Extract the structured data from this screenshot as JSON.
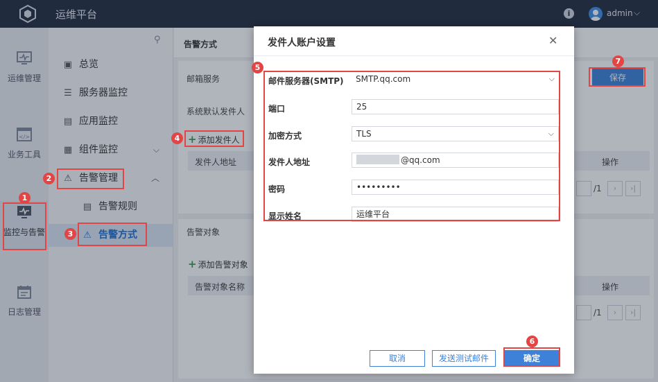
{
  "topbar": {
    "title": "运维平台",
    "user": "admin"
  },
  "rail": [
    {
      "label": "运维管理",
      "icon": "pulse-monitor-icon"
    },
    {
      "label": "业务工具",
      "icon": "code-window-icon"
    },
    {
      "label": "监控与告警",
      "icon": "monitor-alarm-icon",
      "active": true
    },
    {
      "label": "日志管理",
      "icon": "calendar-log-icon"
    }
  ],
  "submenu": [
    {
      "label": "总览",
      "icon": "overview-icon"
    },
    {
      "label": "服务器监控",
      "icon": "server-icon"
    },
    {
      "label": "应用监控",
      "icon": "app-icon"
    },
    {
      "label": "组件监控",
      "icon": "component-icon"
    },
    {
      "label": "告警管理",
      "icon": "warning-icon"
    },
    {
      "label": "告警规则",
      "icon": "rule-icon"
    },
    {
      "label": "告警方式",
      "icon": "warning-icon"
    }
  ],
  "content": {
    "title": "告警方式",
    "mail_service_label": "邮箱服务",
    "default_sender_label": "系统默认发件人",
    "add_sender": "添加发件人",
    "sender_col1": "发件人地址",
    "sender_col_action": "操作",
    "pager_suffix": "/1",
    "target_section": "告警对象",
    "add_target": "添加告警对象",
    "target_col1": "告警对象名称",
    "target_col_action": "操作",
    "save": "保存"
  },
  "dialog": {
    "title": "发件人账户设置",
    "fields": [
      {
        "label": "邮件服务器(SMTP)",
        "value": "SMTP.qq.com",
        "type": "select"
      },
      {
        "label": "端口",
        "value": "25",
        "type": "text"
      },
      {
        "label": "加密方式",
        "value": "TLS",
        "type": "select"
      },
      {
        "label": "发件人地址",
        "value": "@qq.com",
        "type": "text"
      },
      {
        "label": "密码",
        "value": "•••••••••",
        "type": "password"
      },
      {
        "label": "显示姓名",
        "value": "运维平台",
        "type": "text"
      }
    ],
    "cancel": "取消",
    "send_test": "发送测试邮件",
    "confirm": "确定"
  },
  "steps": [
    "1",
    "2",
    "3",
    "4",
    "5",
    "6",
    "7"
  ],
  "colors": {
    "topbar": "#232d40",
    "primary": "#3d82d8",
    "highlight": "#e34444"
  }
}
